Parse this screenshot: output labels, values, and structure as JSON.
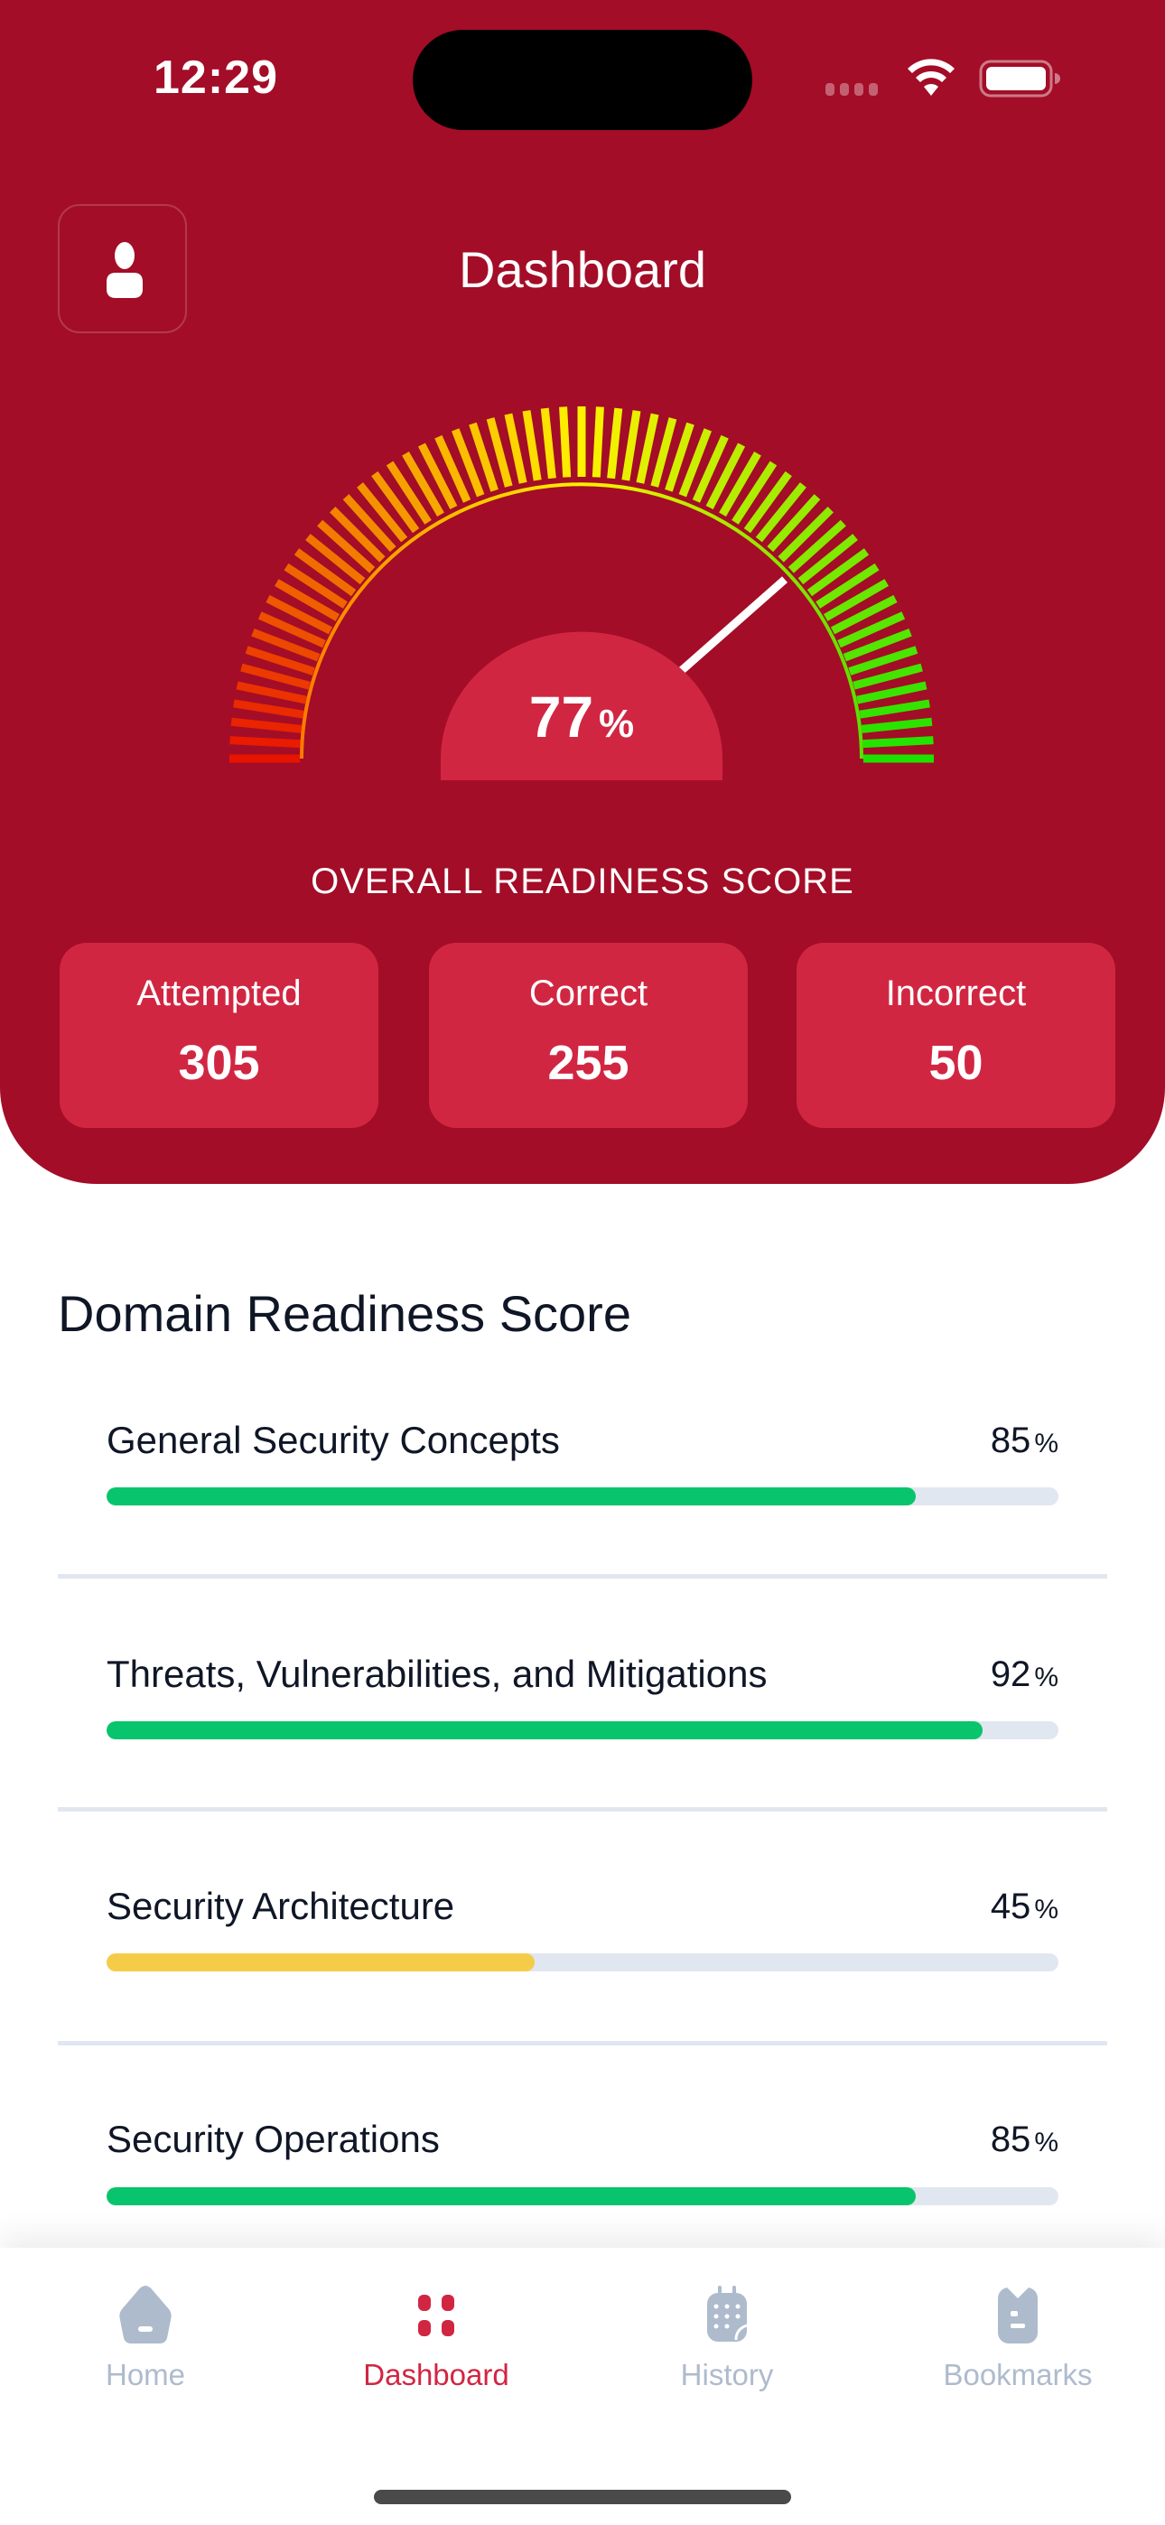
{
  "status_bar": {
    "time": "12:29"
  },
  "header": {
    "title": "Dashboard",
    "profile_icon": "person-icon"
  },
  "gauge": {
    "value_number": "77",
    "value_unit": "%",
    "value_fraction": 0.77,
    "label": "OVERALL READINESS SCORE",
    "colors": {
      "low": "#E81400",
      "mid": "#FFF200",
      "high": "#1DE200",
      "hub": "#D12642",
      "needle": "#FFFFFF"
    }
  },
  "stats": [
    {
      "label": "Attempted",
      "value": "305"
    },
    {
      "label": "Correct",
      "value": "255"
    },
    {
      "label": "Incorrect",
      "value": "50"
    }
  ],
  "domains": {
    "title": "Domain Readiness Score",
    "items": [
      {
        "name": "General Security Concepts",
        "pct": "85",
        "unit": "%",
        "fraction": 0.85,
        "color": "#08C46C"
      },
      {
        "name": "Threats, Vulnerabilities, and Mitigations",
        "pct": "92",
        "unit": "%",
        "fraction": 0.92,
        "color": "#08C46C"
      },
      {
        "name": "Security Architecture",
        "pct": "45",
        "unit": "%",
        "fraction": 0.45,
        "color": "#F5CC48"
      },
      {
        "name": "Security Operations",
        "pct": "85",
        "unit": "%",
        "fraction": 0.85,
        "color": "#08C46C"
      }
    ]
  },
  "tabbar": {
    "items": [
      {
        "label": "Home",
        "icon": "home-icon",
        "active": false
      },
      {
        "label": "Dashboard",
        "icon": "dashboard-grid-icon",
        "active": true
      },
      {
        "label": "History",
        "icon": "calendar-icon",
        "active": false
      },
      {
        "label": "Bookmarks",
        "icon": "bookmark-icon",
        "active": false
      }
    ],
    "active_color": "#D12642",
    "inactive_color": "#AEBBCD"
  },
  "theme": {
    "primary": "#A30D27",
    "card": "#D12642",
    "track": "#E1E7F0"
  }
}
